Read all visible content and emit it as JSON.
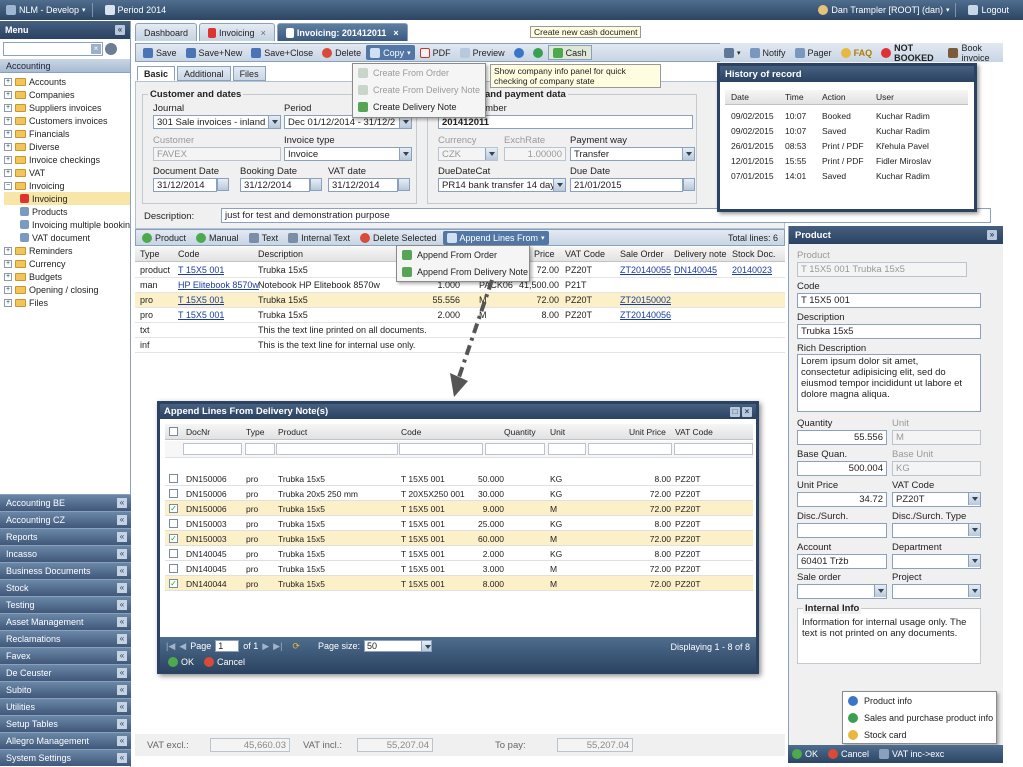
{
  "topbar": {
    "app": "NLM - Develop",
    "period": "Period 2014",
    "user": "Dan Trampler [ROOT] (dan)",
    "logout": "Logout"
  },
  "menu": {
    "title": "Menu",
    "section": "Accounting",
    "tree": [
      {
        "label": "Accounts",
        "type": "plus"
      },
      {
        "label": "Companies",
        "type": "plus"
      },
      {
        "label": "Suppliers invoices",
        "type": "plus"
      },
      {
        "label": "Customers invoices",
        "type": "plus"
      },
      {
        "label": "Financials",
        "type": "plus"
      },
      {
        "label": "Diverse",
        "type": "plus"
      },
      {
        "label": "Invoice checkings",
        "type": "plus"
      },
      {
        "label": "VAT",
        "type": "plus"
      },
      {
        "label": "Invoicing",
        "type": "minus"
      },
      {
        "label": "Invoicing",
        "type": "child",
        "selected": true
      },
      {
        "label": "Products",
        "type": "child"
      },
      {
        "label": "Invoicing multiple booking",
        "type": "child"
      },
      {
        "label": "VAT document",
        "type": "child"
      },
      {
        "label": "Reminders",
        "type": "plus"
      },
      {
        "label": "Currency",
        "type": "plus"
      },
      {
        "label": "Budgets",
        "type": "plus"
      },
      {
        "label": "Opening / closing",
        "type": "plus"
      },
      {
        "label": "Files",
        "type": "plus"
      }
    ],
    "accordion": [
      "Accounting BE",
      "Accounting CZ",
      "Reports",
      "Incasso",
      "Business Documents",
      "Stock",
      "Testing",
      "Asset Management",
      "Reclamations",
      "Favex",
      "De Ceuster",
      "Subito",
      "Utilities",
      "Setup Tables",
      "Allegro Management",
      "System Settings"
    ]
  },
  "tabs": [
    "Dashboard",
    "Invoicing",
    "Invoicing: 201412011"
  ],
  "tooltip_cash": "Create new cash document",
  "toolbar": {
    "save": "Save",
    "save_new": "Save+New",
    "save_close": "Save+Close",
    "delete": "Delete",
    "copy": "Copy",
    "pdf": "PDF",
    "preview": "Preview",
    "cash": "Cash",
    "notify": "Notify",
    "pager": "Pager",
    "faq": "FAQ",
    "not_booked": "NOT BOOKED",
    "book_invoice": "Book invoice"
  },
  "copy_menu": [
    "Create From Order",
    "Create From Delivery Note",
    "Create Delivery Note"
  ],
  "tooltip_info": "Show company info panel for quick checking of company state",
  "subtabs": [
    "Basic",
    "Additional",
    "Files"
  ],
  "form": {
    "customer_dates": "Customer and dates",
    "journal_label": "Journal",
    "journal": "301 Sale invoices - inland",
    "period_label": "Period",
    "period": "Dec 01/12/2014 - 31/12/2",
    "customer_label": "Customer",
    "customer": "FAVEX",
    "invoice_type_label": "Invoice type",
    "invoice_type": "Invoice",
    "doc_date_label": "Document Date",
    "doc_date": "31/12/2014",
    "booking_date_label": "Booking Date",
    "booking_date": "31/12/2014",
    "vat_date_label": "VAT date",
    "vat_date": "31/12/2014",
    "payment_legend": "and payment data",
    "number_label": "Number",
    "number": "201412011",
    "currency_label": "Currency",
    "currency": "CZK",
    "exch_label": "ExchRate",
    "exch": "1.00000",
    "payway_label": "Payment way",
    "payway": "Transfer",
    "duecat_label": "DueDateCat",
    "duecat": "PR14 bank transfer 14 days",
    "duedate_label": "Due Date",
    "duedate": "21/01/2015",
    "description_label": "Description:",
    "description": "just for test and demonstration purpose"
  },
  "history": {
    "title": "History of record",
    "headers": [
      "Date",
      "Time",
      "Action",
      "User"
    ],
    "rows": [
      [
        "09/02/2015",
        "10:07",
        "Booked",
        "Kuchar Radim"
      ],
      [
        "09/02/2015",
        "10:07",
        "Saved",
        "Kuchar Radim"
      ],
      [
        "26/01/2015",
        "08:53",
        "Print / PDF",
        "Křehula Pavel"
      ],
      [
        "12/01/2015",
        "15:55",
        "Print / PDF",
        "Fidler Miroslav"
      ],
      [
        "07/01/2015",
        "14:01",
        "Saved",
        "Kuchar Radim"
      ]
    ]
  },
  "lines_toolbar": {
    "product": "Product",
    "manual": "Manual",
    "text": "Text",
    "internal": "Internal Text",
    "delete": "Delete Selected",
    "append": "Append Lines From",
    "total": "Total lines: 6"
  },
  "append_menu": [
    "Append From Order",
    "Append From Delivery Note"
  ],
  "lines": {
    "headers": [
      "Type",
      "Code",
      "Description",
      "Price",
      "VAT Code",
      "Sale Order",
      "Delivery note",
      "Stock Doc."
    ],
    "rows": [
      {
        "type": "product",
        "code": "T 15X5 001",
        "desc": "Trubka 15x5",
        "qty": "",
        "price": "72.00",
        "vat": "PZ20T",
        "so": "ZT20140055",
        "dn": "DN140045",
        "sd": "20140023",
        "hl": false
      },
      {
        "type": "man",
        "code": "HP Elitebook 8570w",
        "desc": "Notebook HP Elitebook 8570w",
        "qty": "1.000",
        "unit": "PACK06",
        "price": "41,500.00",
        "vat": "P21T",
        "so": "",
        "dn": "",
        "sd": "",
        "hl": false
      },
      {
        "type": "pro",
        "code": "T 15X5 001",
        "desc": "Trubka 15x5",
        "qty": "55.556",
        "unit": "M",
        "price": "72.00",
        "vat": "PZ20T",
        "so": "ZT20150002",
        "dn": "",
        "sd": "",
        "hl": true
      },
      {
        "type": "pro",
        "code": "T 15X5 001",
        "desc": "Trubka 15x5",
        "qty": "2.000",
        "unit": "M",
        "price": "8.00",
        "vat": "PZ20T",
        "so": "ZT20140056",
        "dn": "",
        "sd": "",
        "hl": false
      },
      {
        "type": "txt",
        "code": "",
        "desc": "This the text line printed on all documents.",
        "qty": "",
        "price": "",
        "vat": "",
        "so": "",
        "dn": "",
        "sd": "",
        "hl": false
      },
      {
        "type": "inf",
        "code": "",
        "desc": "This is the text line for internal use only.",
        "qty": "",
        "price": "",
        "vat": "",
        "so": "",
        "dn": "",
        "sd": "",
        "hl": false
      }
    ]
  },
  "popup": {
    "title": "Append Lines From Delivery Note(s)",
    "headers": [
      "DocNr",
      "Type",
      "Product",
      "Code",
      "Quantity",
      "Unit",
      "Unit Price",
      "VAT Code"
    ],
    "rows": [
      {
        "doc": "DN150006",
        "type": "pro",
        "product": "Trubka 15x5",
        "code": "T 15X5 001",
        "qty": "50.000",
        "unit": "KG",
        "price": "8.00",
        "vat": "PZ20T",
        "checked": false
      },
      {
        "doc": "DN150006",
        "type": "pro",
        "product": "Trubka 20x5 250 mm",
        "code": "T 20X5X250 001",
        "qty": "30.000",
        "unit": "KG",
        "price": "72.00",
        "vat": "PZ20T",
        "checked": false
      },
      {
        "doc": "DN150006",
        "type": "pro",
        "product": "Trubka 15x5",
        "code": "T 15X5 001",
        "qty": "9.000",
        "unit": "M",
        "price": "72.00",
        "vat": "PZ20T",
        "checked": true
      },
      {
        "doc": "DN150003",
        "type": "pro",
        "product": "Trubka 15x5",
        "code": "T 15X5 001",
        "qty": "25.000",
        "unit": "KG",
        "price": "8.00",
        "vat": "PZ20T",
        "checked": false
      },
      {
        "doc": "DN150003",
        "type": "pro",
        "product": "Trubka 15x5",
        "code": "T 15X5 001",
        "qty": "60.000",
        "unit": "M",
        "price": "72.00",
        "vat": "PZ20T",
        "checked": true
      },
      {
        "doc": "DN140045",
        "type": "pro",
        "product": "Trubka 15x5",
        "code": "T 15X5 001",
        "qty": "2.000",
        "unit": "KG",
        "price": "8.00",
        "vat": "PZ20T",
        "checked": false
      },
      {
        "doc": "DN140045",
        "type": "pro",
        "product": "Trubka 15x5",
        "code": "T 15X5 001",
        "qty": "3.000",
        "unit": "M",
        "price": "72.00",
        "vat": "PZ20T",
        "checked": false
      },
      {
        "doc": "DN140044",
        "type": "pro",
        "product": "Trubka 15x5",
        "code": "T 15X5 001",
        "qty": "8.000",
        "unit": "M",
        "price": "72.00",
        "vat": "PZ20T",
        "checked": true
      }
    ],
    "page_label": "Page",
    "page": "1",
    "of": "of 1",
    "size_label": "Page size:",
    "size": "50",
    "displaying": "Displaying 1 - 8 of 8",
    "ok": "OK",
    "cancel": "Cancel"
  },
  "product": {
    "title": "Product",
    "product_label": "Product",
    "product": "T 15X5 001  Trubka 15x5",
    "code_label": "Code",
    "code": "T 15X5 001",
    "desc_label": "Description",
    "desc": "Trubka 15x5",
    "rich_label": "Rich Description",
    "rich": "Lorem ipsum dolor sit amet, consectetur adipisicing elit, sed do eiusmod tempor incididunt ut labore et dolore magna aliqua.",
    "qty_label": "Quantity",
    "qty": "55.556",
    "unit_label": "Unit",
    "unit": "M",
    "bq_label": "Base Quan.",
    "bq": "500.004",
    "bu_label": "Base Unit",
    "bu": "KG",
    "up_label": "Unit Price",
    "up": "34.72",
    "vat_label": "VAT Code",
    "vat": "PZ20T",
    "disc_label": "Disc./Surch.",
    "disc_type_label": "Disc./Surch. Type",
    "account_label": "Account",
    "account": "60401  Tržb",
    "dept_label": "Department",
    "so_label": "Sale order",
    "project_label": "Project",
    "internal_title": "Internal Info",
    "internal": "Information for internal usage only. The text is not printed on any documents."
  },
  "context": [
    "Product info",
    "Sales and purchase product info",
    "Stock card"
  ],
  "bottombar": {
    "ok": "OK",
    "cancel": "Cancel",
    "vat": "VAT inc->exc"
  },
  "footer": {
    "vat_excl_label": "VAT excl.:",
    "vat_excl": "45,660.03",
    "vat_incl_label": "VAT incl.:",
    "vat_incl": "55,207.04",
    "to_pay_label": "To pay:",
    "to_pay": "55,207.04"
  }
}
